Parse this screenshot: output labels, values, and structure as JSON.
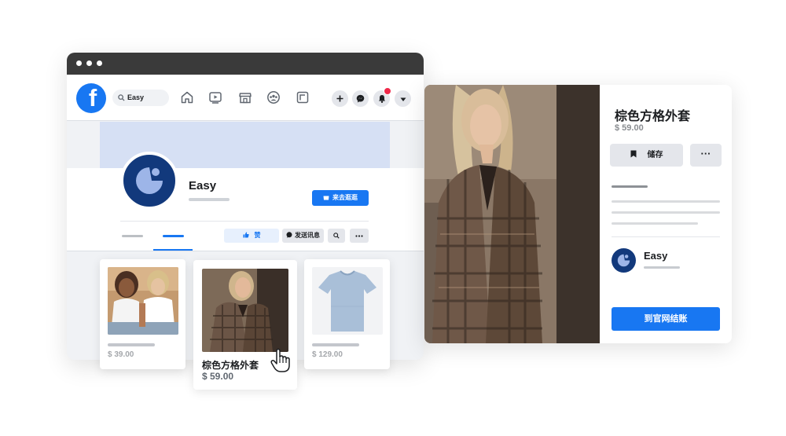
{
  "facebook": {
    "logo_letter": "f",
    "search_text": "Easy",
    "nav_icons": [
      "home-icon",
      "video-icon",
      "marketplace-icon",
      "groups-icon",
      "gaming-icon"
    ],
    "right_icons": [
      "plus-icon",
      "messenger-icon",
      "bell-icon",
      "caret-down-icon"
    ],
    "brand_color": "#1877f2",
    "notification_color": "#f02849"
  },
  "profile": {
    "name": "Easy",
    "visit_button": "来去逛逛",
    "actions": {
      "like": "赞",
      "message": "发送讯息"
    }
  },
  "products": [
    {
      "price": "$ 39.00"
    },
    {
      "title": "棕色方格外套",
      "price": "$ 59.00"
    },
    {
      "price": "$ 129.00"
    }
  ],
  "detail": {
    "title": "棕色方格外套",
    "price": "$ 59.00",
    "save_label": "储存",
    "more_label": "···",
    "seller_name": "Easy",
    "checkout_label": "到官网结账"
  }
}
